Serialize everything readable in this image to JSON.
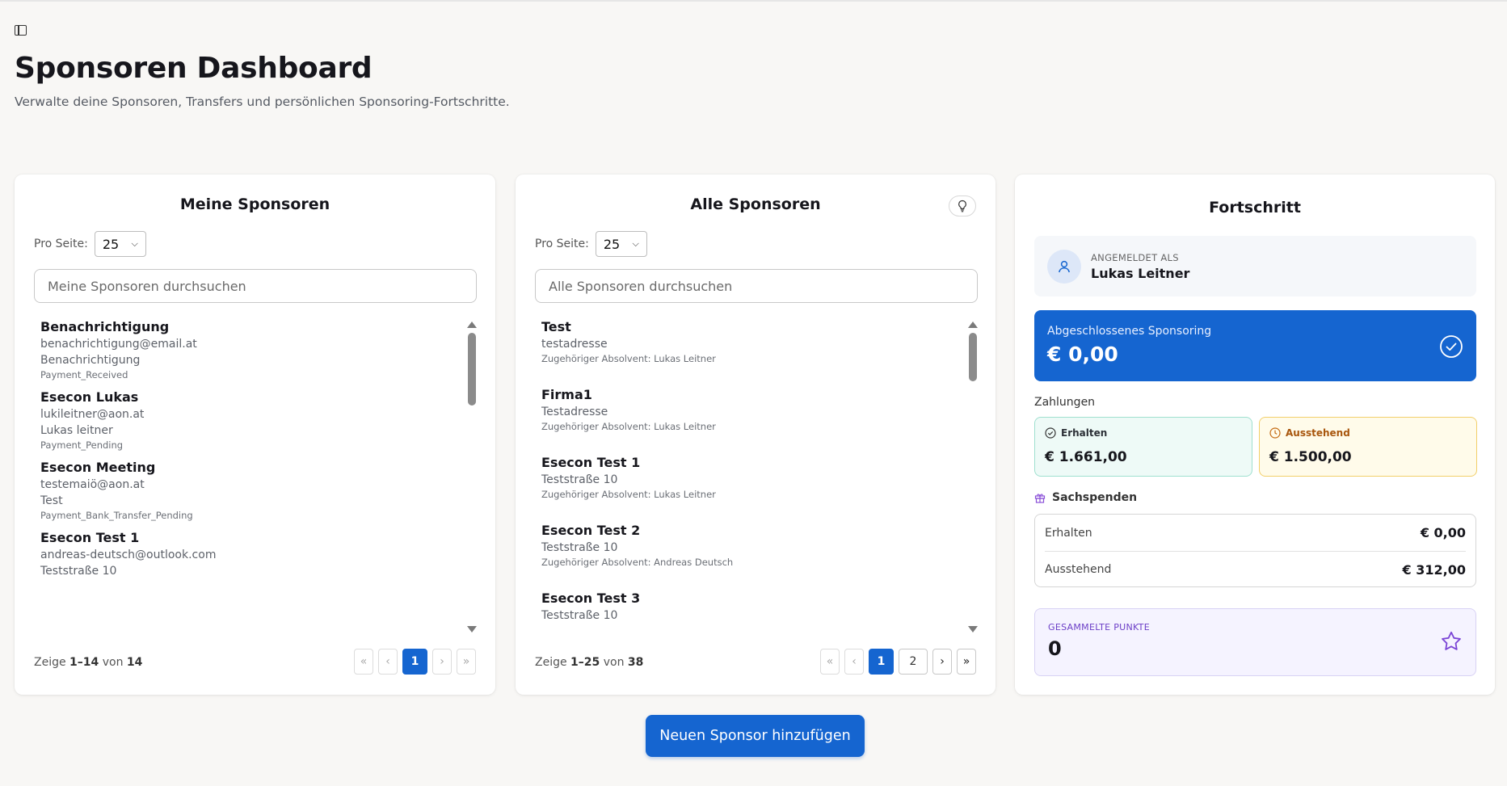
{
  "page": {
    "title": "Sponsoren Dashboard",
    "subtitle": "Verwalte deine Sponsoren, Transfers und persönlichen Sponsoring-Fortschritte."
  },
  "my_sponsors": {
    "title": "Meine Sponsoren",
    "per_page_label": "Pro Seite:",
    "per_page_value": "25",
    "search_placeholder": "Meine Sponsoren durchsuchen",
    "items": [
      {
        "name": "Benachrichtigung",
        "email": "benachrichtigung@email.at",
        "line2": "Benachrichtigung",
        "status": "Payment_Received"
      },
      {
        "name": "Esecon Lukas",
        "email": "lukileitner@aon.at",
        "line2": "Lukas leitner",
        "status": "Payment_Pending"
      },
      {
        "name": "Esecon Meeting",
        "email": "testemaiö@aon.at",
        "line2": "Test",
        "status": "Payment_Bank_Transfer_Pending"
      },
      {
        "name": "Esecon Test 1",
        "email": "andreas-deutsch@outlook.com",
        "line2": "Teststraße 10",
        "status": ""
      }
    ],
    "footer": {
      "prefix": "Zeige",
      "range": "1–14",
      "middle": "von",
      "total": "14"
    },
    "pager": {
      "first": "«",
      "prev": "‹",
      "current": "1",
      "next": "›",
      "last": "»"
    }
  },
  "all_sponsors": {
    "title": "Alle Sponsoren",
    "per_page_label": "Pro Seite:",
    "per_page_value": "25",
    "search_placeholder": "Alle Sponsoren durchsuchen",
    "items": [
      {
        "name": "Test",
        "address": "testadresse",
        "graduate": "Zugehöriger Absolvent: Lukas Leitner"
      },
      {
        "name": "Firma1",
        "address": "Testadresse",
        "graduate": "Zugehöriger Absolvent: Lukas Leitner"
      },
      {
        "name": "Esecon Test 1",
        "address": "Teststraße 10",
        "graduate": "Zugehöriger Absolvent: Lukas Leitner"
      },
      {
        "name": "Esecon Test 2",
        "address": "Teststraße 10",
        "graduate": "Zugehöriger Absolvent: Andreas Deutsch"
      },
      {
        "name": "Esecon Test 3",
        "address": "Teststraße 10",
        "graduate": ""
      }
    ],
    "footer": {
      "prefix": "Zeige",
      "range": "1–25",
      "middle": "von",
      "total": "38"
    },
    "pager": {
      "first": "«",
      "prev": "‹",
      "current": "1",
      "page2": "2",
      "next": "›",
      "last": "»"
    }
  },
  "progress": {
    "title": "Fortschritt",
    "logged_in_label": "ANGEMELDET ALS",
    "user_name": "Lukas Leitner",
    "completed_label": "Abgeschlossenes Sponsoring",
    "completed_value": "€ 0,00",
    "payments_label": "Zahlungen",
    "received_label": "Erhalten",
    "received_value": "€ 1.661,00",
    "pending_label": "Ausstehend",
    "pending_value": "€ 1.500,00",
    "donations_label": "Sachspenden",
    "donations": [
      {
        "label": "Erhalten",
        "value": "€ 0,00"
      },
      {
        "label": "Ausstehend",
        "value": "€ 312,00"
      }
    ],
    "points_label": "GESAMMELTE PUNKTE",
    "points_value": "0"
  },
  "add_button_label": "Neuen Sponsor hinzufügen",
  "colors": {
    "accent": "#1565d0",
    "received_bg": "#eefaf7",
    "pending_bg": "#fffbea",
    "points_bg": "#f5f3ff"
  }
}
